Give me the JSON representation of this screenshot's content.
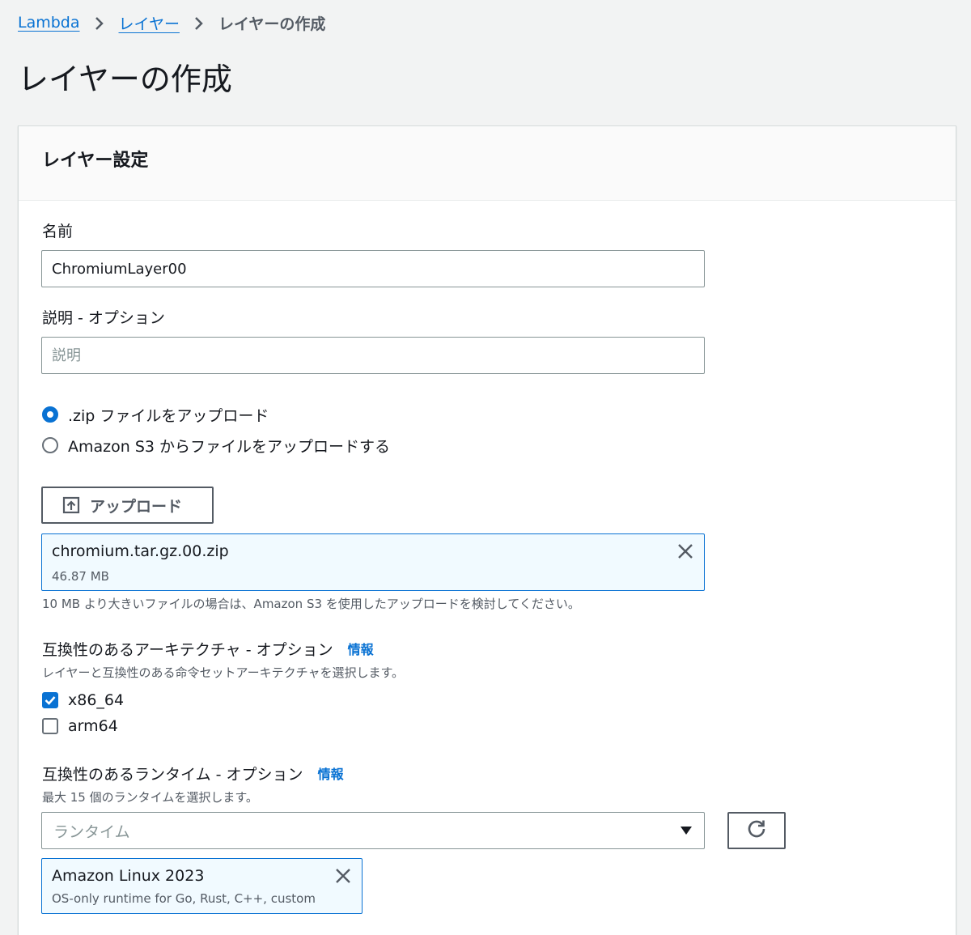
{
  "breadcrumb": {
    "items": [
      "Lambda",
      "レイヤー"
    ],
    "current": "レイヤーの作成"
  },
  "page": {
    "title": "レイヤーの作成"
  },
  "panel": {
    "title": "レイヤー設定",
    "name": {
      "label": "名前",
      "value": "ChromiumLayer00"
    },
    "description": {
      "label": "説明 - オプション",
      "placeholder": "説明",
      "value": ""
    },
    "upload_source": {
      "options": [
        {
          "label": ".zip ファイルをアップロード",
          "selected": true
        },
        {
          "label": "Amazon S3 からファイルをアップロードする",
          "selected": false
        }
      ]
    },
    "upload_button": {
      "label": "アップロード",
      "icon": "upload-icon"
    },
    "file_token": {
      "name": "chromium.tar.gz.00.zip",
      "size": "46.87 MB"
    },
    "file_hint": "10 MB より大きいファイルの場合は、Amazon S3 を使用したアップロードを検討してください。",
    "architectures": {
      "label": "互換性のあるアーキテクチャ - オプション",
      "info": "情報",
      "description": "レイヤーと互換性のある命令セットアーキテクチャを選択します。",
      "options": [
        {
          "label": "x86_64",
          "checked": true
        },
        {
          "label": "arm64",
          "checked": false
        }
      ]
    },
    "runtimes": {
      "label": "互換性のあるランタイム - オプション",
      "info": "情報",
      "description": "最大 15 個のランタイムを選択します。",
      "placeholder": "ランタイム",
      "selected": [
        {
          "name": "Amazon Linux 2023",
          "description": "OS-only runtime for Go, Rust, C++, custom"
        }
      ]
    }
  },
  "colors": {
    "link": "#0972d3",
    "background": "#f2f3f3",
    "text": "#16191f",
    "muted": "#545b64",
    "token_bg": "#f1faff"
  }
}
